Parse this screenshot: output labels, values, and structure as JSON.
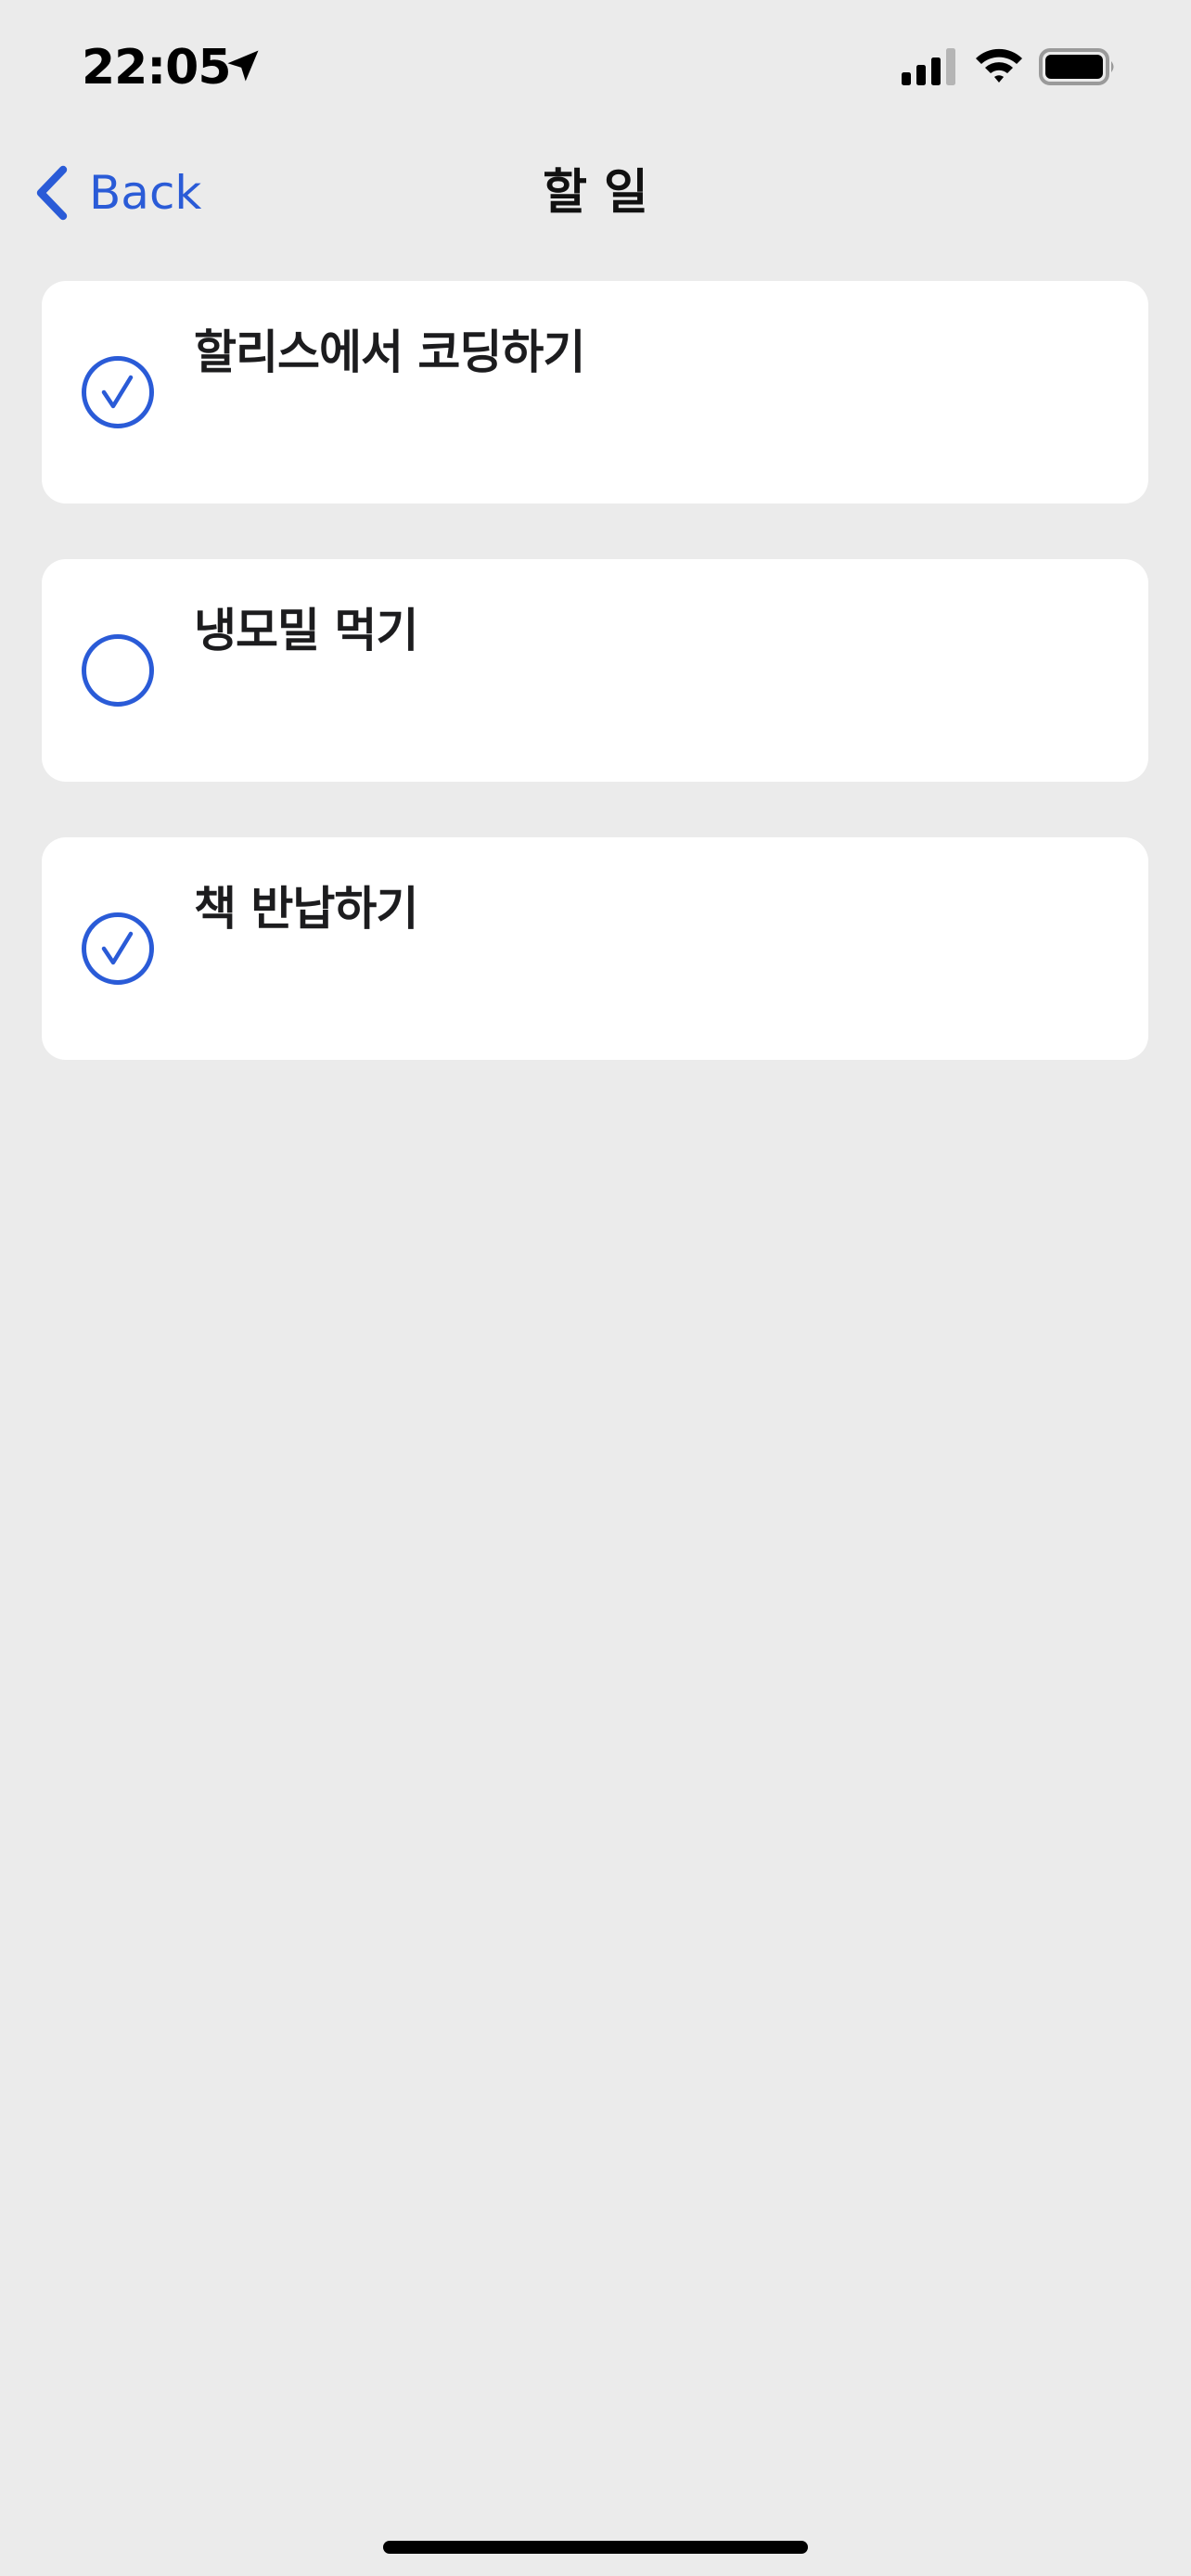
{
  "status_bar": {
    "time": "22:05",
    "icons": [
      "location-arrow-icon",
      "cellular-signal-icon",
      "wifi-icon",
      "battery-icon"
    ]
  },
  "nav": {
    "back_label": "Back",
    "title": "할 일"
  },
  "todos": [
    {
      "label": "할리스에서 코딩하기",
      "checked": true
    },
    {
      "label": "냉모밀 먹기",
      "checked": false
    },
    {
      "label": "책 반납하기",
      "checked": true
    }
  ],
  "colors": {
    "accent": "#2a5bd7",
    "background": "#ebebeb",
    "card": "#ffffff"
  }
}
